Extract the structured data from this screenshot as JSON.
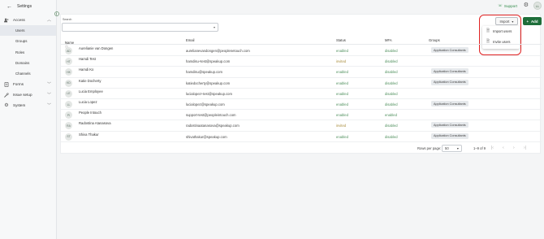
{
  "sidebar": {
    "back_label": "Settings",
    "sections": [
      {
        "label": "Access",
        "icon": "users-icon",
        "expanded": true
      },
      {
        "label": "Forms",
        "icon": "document-icon"
      },
      {
        "label": "Issue setup",
        "icon": "wrench-icon"
      },
      {
        "label": "System",
        "icon": "gear-icon"
      }
    ],
    "access_items": [
      "Users",
      "Groups",
      "Roles",
      "Domains",
      "Channels"
    ],
    "active_item": "Users"
  },
  "header": {
    "support_label": "Support",
    "avatar_initials": "LL"
  },
  "search": {
    "label": "Search",
    "value": ""
  },
  "toolbar": {
    "import_label": "Import",
    "add_label": "Add",
    "import_menu": [
      "Import users",
      "Invite users"
    ]
  },
  "table": {
    "columns": [
      "Name",
      "Email",
      "Status",
      "MFA",
      "Groups"
    ],
    "rows": [
      {
        "initials": "AD",
        "name": "Aurelianie van Dongen",
        "email": "aurelianevandongen@peoplenetouch.com",
        "status": "enabled",
        "mfa": "disabled",
        "group": "Application Consultants"
      },
      {
        "initials": "HT",
        "name": "Hamdi Test",
        "email": "hamdisu+test@speakup.com",
        "status": "invited",
        "mfa": "disabled",
        "group": ""
      },
      {
        "initials": "HK",
        "name": "Hamdi Ko",
        "email": "hamdisu@speakup.com",
        "status": "enabled",
        "mfa": "disabled",
        "group": "Application Consultants"
      },
      {
        "initials": "KD",
        "name": "Katie Docherty",
        "email": "katiedocherty@speakup.com",
        "status": "enabled",
        "mfa": "disabled",
        "group": "Application Consultants"
      },
      {
        "initials": "LE",
        "name": "Lucia Employee",
        "email": "lucialopez+test@speakup.com",
        "status": "enabled",
        "mfa": "disabled",
        "group": ""
      },
      {
        "initials": "LL",
        "name": "Lucia Lopez",
        "email": "lucialopez@speakup.com",
        "status": "enabled",
        "mfa": "disabled",
        "group": "Application Consultants"
      },
      {
        "initials": "PI",
        "name": "People Intouch",
        "email": "support-test@peopleintouch.com",
        "status": "enabled",
        "mfa": "enabled",
        "group": ""
      },
      {
        "initials": "RA",
        "name": "Radostina Atanasova",
        "email": "radostinaatanasova@speakup.com",
        "status": "invited",
        "mfa": "disabled",
        "group": "Application Consultants"
      },
      {
        "initials": "ST",
        "name": "Shiva Thakur",
        "email": "shivathakur@speakup.com",
        "status": "enabled",
        "mfa": "disabled",
        "group": "Application Consultants"
      }
    ]
  },
  "pagination": {
    "rows_per_page_label": "Rows per page:",
    "rows_per_page": "50",
    "range": "1–9 of 9"
  },
  "colors": {
    "accent": "#1e6e3a",
    "enabled": "#4e8f5c",
    "invited": "#a88b3a",
    "highlight": "#e02222"
  }
}
